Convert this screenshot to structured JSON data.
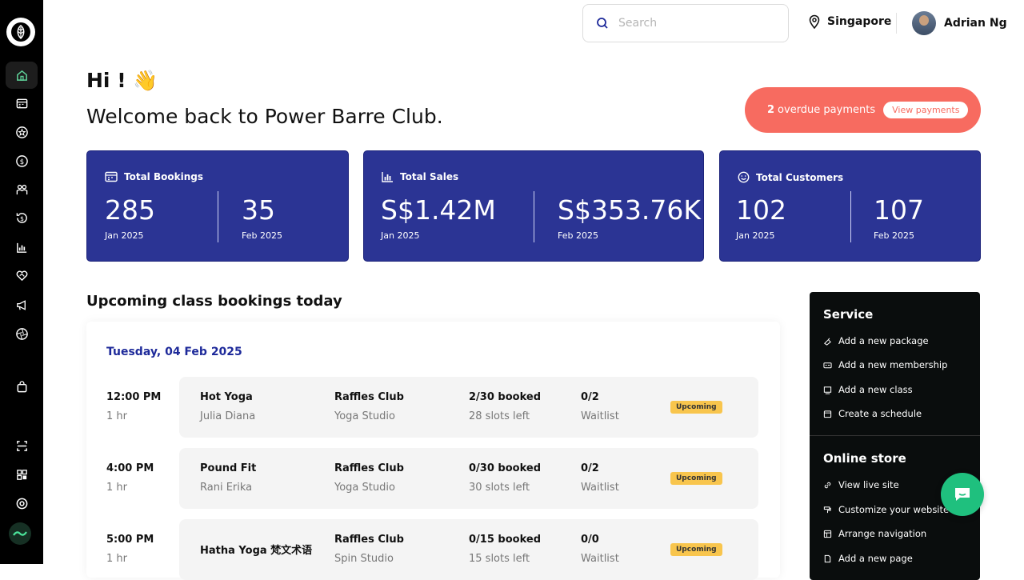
{
  "header": {
    "search_placeholder": "Search",
    "location": "Singapore",
    "user_name": "Adrian Ng"
  },
  "greeting": {
    "hi": "Hi !",
    "emoji": "👋",
    "welcome": "Welcome back to Power Barre Club."
  },
  "overdue": {
    "count": "2",
    "text": "overdue payments",
    "button": "View payments"
  },
  "stats": [
    {
      "title": "Total Bookings",
      "icon": "calendar-icon",
      "a_value": "285",
      "a_label": "Jan 2025",
      "b_value": "35",
      "b_label": "Feb 2025"
    },
    {
      "title": "Total Sales",
      "icon": "bar-chart-icon",
      "a_value": "S$1.42M",
      "a_label": "Jan 2025",
      "b_value": "S$353.76K",
      "b_label": "Feb 2025"
    },
    {
      "title": "Total Customers",
      "icon": "smiley-icon",
      "a_value": "102",
      "a_label": "Jan 2025",
      "b_value": "107",
      "b_label": "Feb 2025"
    }
  ],
  "bookings": {
    "section_title": "Upcoming class bookings today",
    "date": "Tuesday, 04 Feb 2025",
    "rows": [
      {
        "time": "12:00 PM",
        "duration": "1 hr",
        "class": "Hot Yoga",
        "instructor": "Julia Diana",
        "location": "Raffles Club",
        "room": "Yoga Studio",
        "booked": "2/30 booked",
        "slots": "28 slots left",
        "waitlist": "0/2",
        "waitlist_label": "Waitlist",
        "status": "Upcoming"
      },
      {
        "time": "4:00 PM",
        "duration": "1 hr",
        "class": "Pound Fit",
        "instructor": "Rani Erika",
        "location": "Raffles Club",
        "room": "Yoga Studio",
        "booked": "0/30 booked",
        "slots": "30 slots left",
        "waitlist": "0/2",
        "waitlist_label": "Waitlist",
        "status": "Upcoming"
      },
      {
        "time": "5:00 PM",
        "duration": "1 hr",
        "class": "Hatha Yoga 梵文术语",
        "instructor": "",
        "location": "Raffles Club",
        "room": "Spin Studio",
        "booked": "0/15 booked",
        "slots": "15 slots left",
        "waitlist": "0/0",
        "waitlist_label": "Waitlist",
        "status": "Upcoming"
      }
    ]
  },
  "quick_actions": {
    "service_title": "Service",
    "service_items": [
      "Add a new package",
      "Add a new membership",
      "Add a new class",
      "Create a schedule"
    ],
    "store_title": "Online store",
    "store_items": [
      "View live site",
      "Customize your website",
      "Arrange navigation",
      "Add a new page"
    ]
  },
  "colors": {
    "card_bg": "#2b3494",
    "overdue_bg": "#f76b60",
    "badge_bg": "#f8c54d",
    "date_blue": "#1e2a9a",
    "chat_green": "#1fc07e"
  }
}
